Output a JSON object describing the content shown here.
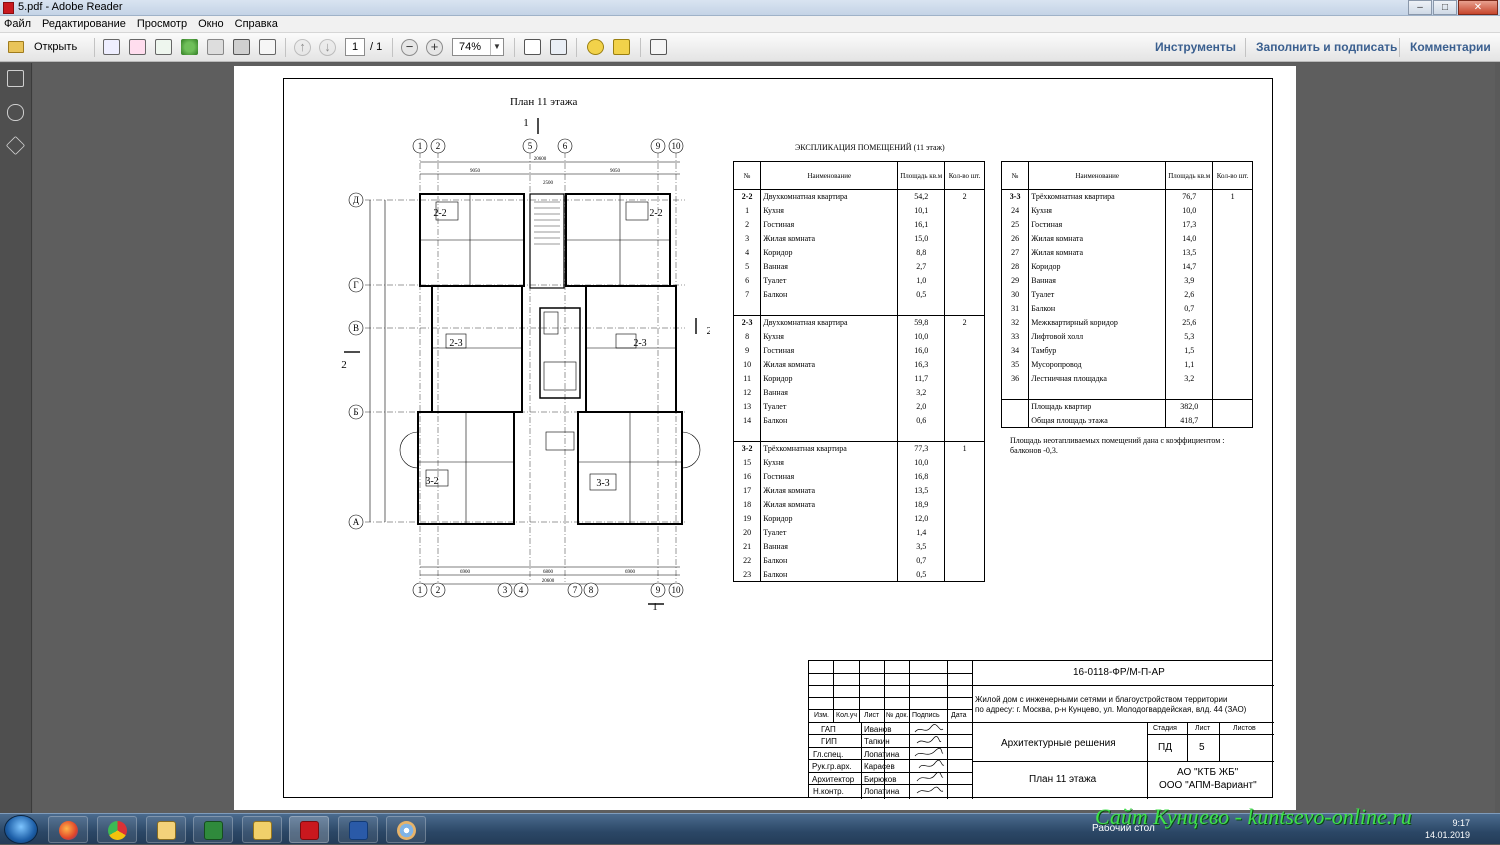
{
  "window": {
    "title": "5.pdf - Adobe Reader",
    "min": "–",
    "max": "□",
    "close": "✕"
  },
  "menu": [
    "Файл",
    "Редактирование",
    "Просмотр",
    "Окно",
    "Справка"
  ],
  "toolbar": {
    "open_label": "Открыть",
    "page_current": "1",
    "page_total": "/ 1",
    "zoom": "74%",
    "tools_label": "Инструменты",
    "fill_sign_label": "Заполнить и подписать",
    "comments_label": "Комментарии"
  },
  "plan": {
    "title": "План 11 этажа",
    "axes_top": [
      "1",
      "2",
      "5",
      "6",
      "9",
      "10"
    ],
    "axes_bottom": [
      "1",
      "2",
      "3",
      "4",
      "7",
      "8",
      "9",
      "10"
    ],
    "axes_left": [
      "Д",
      "Г",
      "В",
      "Б",
      "А"
    ],
    "dims_top": [
      "20600",
      "9050",
      "2500",
      "9050"
    ],
    "dims_bottom": [
      "6900",
      "6800",
      "6900",
      "20600"
    ],
    "section_marks": [
      "1",
      "2"
    ],
    "apartments": [
      "2-2",
      "2-2",
      "2-3",
      "2-3",
      "3-2",
      "3-3"
    ]
  },
  "table_title": "ЭКСПЛИКАЦИЯ ПОМЕЩЕНИЙ (11 этаж)",
  "table1": {
    "headers": [
      "№",
      "Наименование",
      "Площадь кв.м",
      "Кол-во шт."
    ],
    "rows": [
      [
        "2-2",
        "Двухкомнатная квартира",
        "54,2",
        "2"
      ],
      [
        "1",
        "Кухня",
        "10,1",
        ""
      ],
      [
        "2",
        "Гостиная",
        "16,1",
        ""
      ],
      [
        "3",
        "Жилая комната",
        "15,0",
        ""
      ],
      [
        "4",
        "Коридор",
        "8,8",
        ""
      ],
      [
        "5",
        "Ванная",
        "2,7",
        ""
      ],
      [
        "6",
        "Туалет",
        "1,0",
        ""
      ],
      [
        "7",
        "Балкон",
        "0,5",
        ""
      ],
      [
        "",
        "",
        "",
        ""
      ],
      [
        "2-3",
        "Двухкомнатная квартира",
        "59,8",
        "2"
      ],
      [
        "8",
        "Кухня",
        "10,0",
        ""
      ],
      [
        "9",
        "Гостиная",
        "16,0",
        ""
      ],
      [
        "10",
        "Жилая комната",
        "16,3",
        ""
      ],
      [
        "11",
        "Коридор",
        "11,7",
        ""
      ],
      [
        "12",
        "Ванная",
        "3,2",
        ""
      ],
      [
        "13",
        "Туалет",
        "2,0",
        ""
      ],
      [
        "14",
        "Балкон",
        "0,6",
        ""
      ],
      [
        "",
        "",
        "",
        ""
      ],
      [
        "3-2",
        "Трёхкомнатная квартира",
        "77,3",
        "1"
      ],
      [
        "15",
        "Кухня",
        "10,0",
        ""
      ],
      [
        "16",
        "Гостиная",
        "16,8",
        ""
      ],
      [
        "17",
        "Жилая комната",
        "13,5",
        ""
      ],
      [
        "18",
        "Жилая комната",
        "18,9",
        ""
      ],
      [
        "19",
        "Коридор",
        "12,0",
        ""
      ],
      [
        "20",
        "Туалет",
        "1,4",
        ""
      ],
      [
        "21",
        "Ванная",
        "3,5",
        ""
      ],
      [
        "22",
        "Балкон",
        "0,7",
        ""
      ],
      [
        "23",
        "Балкон",
        "0,5",
        ""
      ]
    ]
  },
  "table2": {
    "headers": [
      "№",
      "Наименование",
      "Площадь кв.м",
      "Кол-во шт."
    ],
    "rows": [
      [
        "3-3",
        "Трёхкомнатная квартира",
        "76,7",
        "1"
      ],
      [
        "24",
        "Кухня",
        "10,0",
        ""
      ],
      [
        "25",
        "Гостиная",
        "17,3",
        ""
      ],
      [
        "26",
        "Жилая комната",
        "14,0",
        ""
      ],
      [
        "27",
        "Жилая комната",
        "13,5",
        ""
      ],
      [
        "28",
        "Коридор",
        "14,7",
        ""
      ],
      [
        "29",
        "Ванная",
        "3,9",
        ""
      ],
      [
        "30",
        "Туалет",
        "2,6",
        ""
      ],
      [
        "31",
        "Балкон",
        "0,7",
        ""
      ],
      [
        "32",
        "Межквартирный коридор",
        "25,6",
        ""
      ],
      [
        "33",
        "Лифтовой холл",
        "5,3",
        ""
      ],
      [
        "34",
        "Тамбур",
        "1,5",
        ""
      ],
      [
        "35",
        "Мусоропровод",
        "1,1",
        ""
      ],
      [
        "36",
        "Лестничная площадка",
        "3,2",
        ""
      ],
      [
        "",
        "",
        "",
        ""
      ],
      [
        "",
        "Площадь квартир",
        "382,0",
        ""
      ],
      [
        "",
        "Общая площадь этажа",
        "418,7",
        ""
      ]
    ]
  },
  "note": "Площадь неотапливаемых помещений дана с коэффициентом : балконов -0,3.",
  "stamp": {
    "code": "16-0118-ФР/М-П-АР",
    "object_line1": "Жилой дом с инженерными сетями и благоустройством территории",
    "object_line2": "по адресу: г. Москва, р-н Кунцево, ул. Молодогвардейская, влд. 44 (ЗАО)",
    "col_headers": [
      "Изм.",
      "Кол.уч",
      "Лист",
      "№ док.",
      "Подпись",
      "Дата"
    ],
    "roles": [
      [
        "ГАП",
        "Иванов"
      ],
      [
        "ГИП",
        "Тапкин"
      ],
      [
        "Гл.спец.",
        "Лопатина"
      ],
      [
        "Рук.гр.арх.",
        "Карасев"
      ],
      [
        "Архитектор",
        "Бирюков"
      ],
      [
        "Н.контр.",
        "Лопатина"
      ]
    ],
    "section": "Архитектурные решения",
    "stage_hdr": "Стадия",
    "sheet_hdr": "Лист",
    "sheets_hdr": "Листов",
    "stage": "ПД",
    "sheet": "5",
    "sheets": "",
    "drawing": "План 11 этажа",
    "org1": "АО \"КТБ ЖБ\"",
    "org2": "ООО \"АПМ-Вариант\""
  },
  "taskbar": {
    "desktop_label": "Рабочий стол",
    "time": "9:17",
    "date": "14.01.2019"
  },
  "watermark": "Сайт Кунцево - kuntsevo-online.ru",
  "colors": {
    "accent_link": "#3a5f8f",
    "watermark": "#3fe24a"
  }
}
